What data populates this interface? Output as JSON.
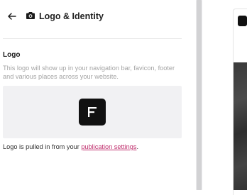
{
  "header": {
    "title": "Logo & Identity",
    "back_icon": "arrow-left-icon",
    "title_icon": "camera-icon"
  },
  "logo_section": {
    "label": "Logo",
    "description": "This logo will show up in your navigation bar, favicon, footer and various places across your website."
  },
  "footer_note": {
    "prefix": "Logo is pulled in from your ",
    "link_text": "publication settings",
    "suffix": "."
  },
  "colors": {
    "accent_link": "#c0306e",
    "preview_bg": "#f1f1f3",
    "logo_bg": "#111111"
  }
}
